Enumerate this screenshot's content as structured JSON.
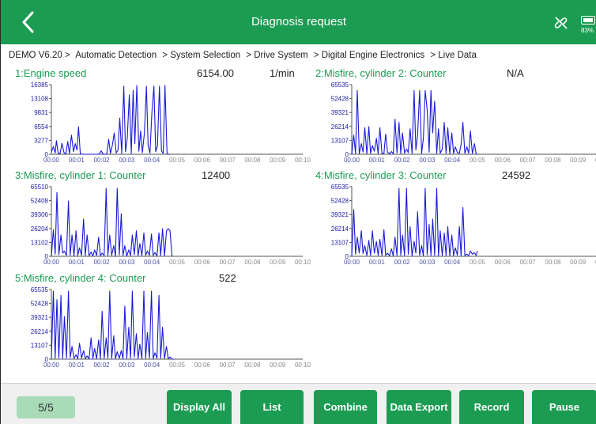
{
  "header": {
    "title": "Diagnosis request",
    "battery_pct": "83%",
    "battery_level": 0.83
  },
  "breadcrumb": [
    "DEMO V6.20 >",
    "Automatic Detection",
    "> System Selection",
    "> Drive System",
    "> Digital Engine Electronics",
    "> Live Data"
  ],
  "panels": [
    {
      "name": "1:Engine speed",
      "value": "6154.00",
      "unit": "1/min",
      "yticks": [
        "16385",
        "13108",
        "9831",
        "6554",
        "3277",
        "0"
      ]
    },
    {
      "name": "2:Misfire, cylinder 2: Counter",
      "value": "N/A",
      "unit": "",
      "yticks": [
        "65535",
        "52428",
        "39321",
        "26214",
        "13107",
        "0"
      ]
    },
    {
      "name": "3:Misfire, cylinder 1: Counter",
      "value": "12400",
      "unit": "",
      "yticks": [
        "65510",
        "52408",
        "39306",
        "26204",
        "13102",
        "0"
      ]
    },
    {
      "name": "4:Misfire, cylinder 3: Counter",
      "value": "24592",
      "unit": "",
      "yticks": [
        "65535",
        "52428",
        "39321",
        "26214",
        "13107",
        "0"
      ]
    },
    {
      "name": "5:Misfire, cylinder 4: Counter",
      "value": "522",
      "unit": "",
      "yticks": [
        "65535",
        "52428",
        "39321",
        "26214",
        "13107",
        "0"
      ]
    }
  ],
  "xticks": [
    "00:00",
    "00:01",
    "00:02",
    "00:03",
    "00:04",
    "00:05",
    "00:06",
    "00:07",
    "00:08",
    "00:09",
    "00:10"
  ],
  "chart_data": [
    {
      "type": "line",
      "title": "1:Engine speed",
      "ylim": [
        0,
        16385
      ],
      "xlim": [
        0,
        10
      ],
      "x": [
        0,
        0.08,
        0.15,
        0.2,
        0.27,
        0.35,
        0.42,
        0.5,
        0.58,
        0.65,
        0.72,
        0.8,
        0.88,
        0.95,
        1.02,
        1.08,
        1.15,
        1.22,
        1.3,
        1.38,
        1.45,
        1.52,
        1.6,
        1.68,
        1.75,
        1.82,
        1.9,
        1.98,
        2.05,
        2.12,
        2.2,
        2.28,
        2.35,
        2.42,
        2.5,
        2.58,
        2.65,
        2.72,
        2.8,
        2.88,
        2.95,
        3.02,
        3.1,
        3.18,
        3.25,
        3.32,
        3.4,
        3.48,
        3.55,
        3.62,
        3.7,
        3.78,
        3.85,
        3.92,
        4.0,
        4.08,
        4.15,
        4.22,
        4.3,
        4.38,
        4.45,
        4.52,
        4.6,
        4.65,
        4.72
      ],
      "y": [
        500,
        1800,
        300,
        3200,
        200,
        200,
        2600,
        400,
        100,
        3000,
        200,
        4500,
        600,
        2500,
        1000,
        6500,
        100,
        0,
        0,
        0,
        0,
        0,
        0,
        0,
        0,
        0,
        0,
        800,
        100,
        0,
        0,
        3500,
        200,
        2000,
        5000,
        300,
        1000,
        8500,
        200,
        16000,
        600,
        3800,
        14000,
        200,
        15000,
        2500,
        16200,
        700,
        5500,
        400,
        5000,
        16000,
        2000,
        300,
        10000,
        16000,
        600,
        2000,
        16000,
        800,
        200,
        16200,
        300,
        0,
        0
      ]
    },
    {
      "type": "line",
      "title": "2:Misfire, cylinder 2: Counter",
      "ylim": [
        0,
        65535
      ],
      "xlim": [
        0,
        10
      ],
      "x": [
        0,
        0.08,
        0.15,
        0.22,
        0.3,
        0.38,
        0.45,
        0.52,
        0.6,
        0.68,
        0.75,
        0.82,
        0.9,
        0.98,
        1.05,
        1.12,
        1.2,
        1.28,
        1.35,
        1.42,
        1.5,
        1.58,
        1.65,
        1.72,
        1.8,
        1.88,
        1.95,
        2.02,
        2.1,
        2.18,
        2.25,
        2.32,
        2.4,
        2.48,
        2.55,
        2.62,
        2.7,
        2.78,
        2.85,
        2.92,
        3.0,
        3.08,
        3.15,
        3.22,
        3.3,
        3.38,
        3.45,
        3.52,
        3.6,
        3.68,
        3.75,
        3.82,
        3.9,
        3.98,
        4.05,
        4.12,
        4.2,
        4.28,
        4.35,
        4.42,
        4.5,
        4.58,
        4.65,
        4.72,
        4.8,
        4.88,
        4.95,
        5.0
      ],
      "y": [
        0,
        18000,
        800,
        60000,
        500,
        10000,
        2000,
        25000,
        600,
        26000,
        1000,
        8000,
        3000,
        15000,
        500,
        25000,
        800,
        500,
        19000,
        2000,
        500,
        2500,
        600,
        33000,
        1200,
        30000,
        800,
        20000,
        1000,
        5000,
        1500,
        24000,
        800,
        60000,
        4000,
        18000,
        60000,
        800,
        15000,
        60000,
        42000,
        2000,
        60000,
        20000,
        50000,
        800,
        24000,
        1000,
        5000,
        30000,
        1000,
        25000,
        600,
        20000,
        800,
        7000,
        1500,
        800,
        9000,
        30000,
        800,
        7000,
        1000,
        22000,
        800,
        10000,
        300,
        0
      ]
    },
    {
      "type": "line",
      "title": "3:Misfire, cylinder 1: Counter",
      "ylim": [
        0,
        65510
      ],
      "xlim": [
        0,
        10
      ],
      "x": [
        0,
        0.08,
        0.15,
        0.22,
        0.3,
        0.38,
        0.45,
        0.52,
        0.6,
        0.68,
        0.75,
        0.82,
        0.9,
        0.98,
        1.05,
        1.12,
        1.2,
        1.28,
        1.35,
        1.42,
        1.5,
        1.58,
        1.65,
        1.72,
        1.8,
        1.88,
        1.95,
        2.02,
        2.1,
        2.18,
        2.25,
        2.32,
        2.4,
        2.48,
        2.55,
        2.62,
        2.7,
        2.78,
        2.85,
        2.92,
        3.0,
        3.08,
        3.15,
        3.22,
        3.3,
        3.38,
        3.45,
        3.52,
        3.6,
        3.68,
        3.75,
        3.82,
        3.9,
        3.98,
        4.05,
        4.12,
        4.2,
        4.28,
        4.35,
        4.42,
        4.5,
        4.58,
        4.65,
        4.72,
        4.8
      ],
      "y": [
        0,
        25000,
        2000,
        60000,
        1500,
        20000,
        3000,
        5000,
        800,
        52000,
        1000,
        20000,
        500,
        24000,
        800,
        8000,
        1000,
        35000,
        800,
        20000,
        600,
        4000,
        300,
        6000,
        800,
        18000,
        500,
        3000,
        800,
        64000,
        1000,
        20000,
        900,
        10000,
        300,
        64000,
        1200,
        40000,
        800,
        10000,
        300,
        6000,
        800,
        20000,
        1500,
        24000,
        600,
        12000,
        800,
        22000,
        1000,
        5000,
        900,
        21000,
        800,
        3500,
        500,
        22000,
        800,
        26000,
        400,
        24000,
        26000,
        24000,
        0
      ]
    },
    {
      "type": "line",
      "title": "4:Misfire, cylinder 3: Counter",
      "ylim": [
        0,
        65535
      ],
      "xlim": [
        0,
        10
      ],
      "x": [
        0,
        0.08,
        0.15,
        0.22,
        0.3,
        0.38,
        0.45,
        0.52,
        0.6,
        0.68,
        0.75,
        0.82,
        0.9,
        0.98,
        1.05,
        1.12,
        1.2,
        1.28,
        1.35,
        1.42,
        1.5,
        1.58,
        1.65,
        1.72,
        1.8,
        1.88,
        1.95,
        2.02,
        2.1,
        2.18,
        2.25,
        2.32,
        2.4,
        2.48,
        2.55,
        2.62,
        2.7,
        2.78,
        2.85,
        2.92,
        3.0,
        3.08,
        3.15,
        3.22,
        3.3,
        3.38,
        3.45,
        3.52,
        3.6,
        3.68,
        3.75,
        3.82,
        3.9,
        3.98,
        4.05,
        4.12,
        4.2,
        4.28,
        4.35,
        4.42,
        4.5,
        4.58,
        4.65,
        4.72,
        4.8,
        4.88,
        4.95,
        5.0
      ],
      "y": [
        0,
        44000,
        2000,
        18000,
        3000,
        24000,
        2500,
        10000,
        800,
        15000,
        1000,
        24000,
        3000,
        14000,
        900,
        16000,
        800,
        25000,
        900,
        3000,
        600,
        7000,
        400,
        18000,
        800,
        64000,
        1000,
        20000,
        800,
        64000,
        2000,
        28000,
        600,
        14000,
        3000,
        42000,
        1000,
        10000,
        600,
        64000,
        1500,
        30000,
        800,
        35000,
        1000,
        64000,
        600,
        24000,
        800,
        22000,
        1000,
        28000,
        600,
        20000,
        800,
        8000,
        1200,
        28000,
        600,
        46000,
        800,
        2000,
        800,
        5000,
        2000,
        3500,
        800,
        5000
      ]
    },
    {
      "type": "line",
      "title": "5:Misfire, cylinder 4: Counter",
      "ylim": [
        0,
        65535
      ],
      "xlim": [
        0,
        10
      ],
      "x": [
        0,
        0.08,
        0.15,
        0.22,
        0.3,
        0.38,
        0.45,
        0.52,
        0.6,
        0.68,
        0.75,
        0.82,
        0.9,
        0.98,
        1.05,
        1.12,
        1.2,
        1.28,
        1.35,
        1.42,
        1.5,
        1.58,
        1.65,
        1.72,
        1.8,
        1.88,
        1.95,
        2.02,
        2.1,
        2.18,
        2.25,
        2.32,
        2.4,
        2.48,
        2.55,
        2.62,
        2.7,
        2.78,
        2.85,
        2.92,
        3.0,
        3.08,
        3.15,
        3.22,
        3.3,
        3.38,
        3.45,
        3.52,
        3.6,
        3.68,
        3.75,
        3.82,
        3.9,
        3.98,
        4.05,
        4.12,
        4.2,
        4.28,
        4.35,
        4.42,
        4.5,
        4.58,
        4.65,
        4.72,
        4.8,
        4.88
      ],
      "y": [
        0,
        64000,
        800,
        56000,
        1200,
        60000,
        800,
        40000,
        1000,
        64000,
        1500,
        12000,
        800,
        4000,
        600,
        15000,
        800,
        8000,
        500,
        3000,
        400,
        20000,
        700,
        10000,
        400,
        18000,
        600,
        45000,
        800,
        20000,
        1000,
        64000,
        900,
        22000,
        600,
        7000,
        800,
        8000,
        600,
        50000,
        800,
        30000,
        1000,
        64000,
        2000,
        24000,
        800,
        14000,
        600,
        64000,
        800,
        25000,
        1000,
        64000,
        600,
        6000,
        900,
        60000,
        800,
        30000,
        600,
        12000,
        400,
        2000,
        0,
        0
      ]
    }
  ]
}
